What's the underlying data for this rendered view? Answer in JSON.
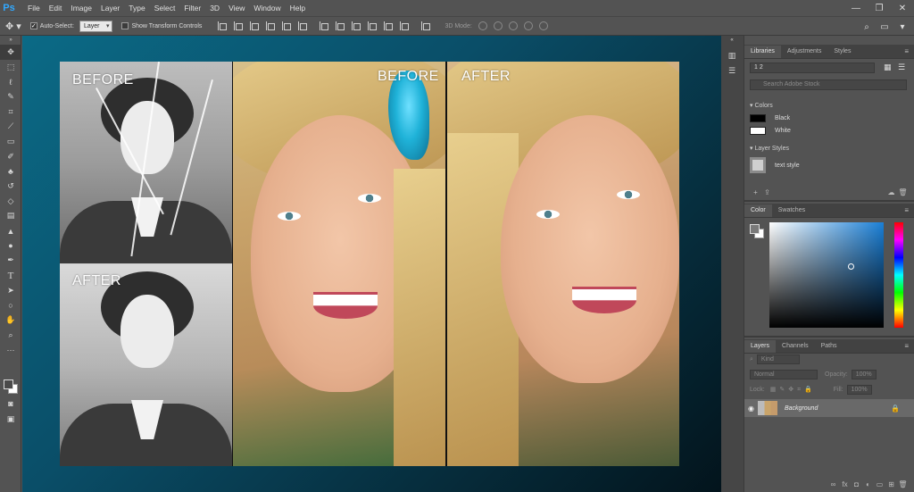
{
  "app": {
    "logo": "Ps"
  },
  "menu": [
    "File",
    "Edit",
    "Image",
    "Layer",
    "Type",
    "Select",
    "Filter",
    "3D",
    "View",
    "Window",
    "Help"
  ],
  "window_controls": [
    "—",
    "❐",
    "✕"
  ],
  "options": {
    "auto_select_label": "Auto-Select:",
    "auto_select_value": "Layer",
    "transform_label": "Show Transform Controls",
    "mode_3d": "3D Mode:"
  },
  "canvas": {
    "label_bw_before": "BEFORE",
    "label_bw_after": "AFTER",
    "label_before": "BEFORE",
    "label_after": "AFTER"
  },
  "libraries": {
    "tabs": [
      "Libraries",
      "Adjustments",
      "Styles"
    ],
    "library_name": "1 2",
    "search_placeholder": "Search Adobe Stock",
    "colors_header": "Colors",
    "colors": [
      {
        "name": "Black",
        "hex": "#000000"
      },
      {
        "name": "White",
        "hex": "#ffffff"
      }
    ],
    "layer_styles_header": "Layer Styles",
    "styles": [
      "text style"
    ]
  },
  "color_panel": {
    "tabs": [
      "Color",
      "Swatches"
    ]
  },
  "layers_panel": {
    "tabs": [
      "Layers",
      "Channels",
      "Paths"
    ],
    "kind": "Kind",
    "blend": "Normal",
    "opacity_label": "Opacity:",
    "opacity": "100%",
    "lock_label": "Lock:",
    "fill_label": "Fill:",
    "fill": "100%",
    "layer_name": "Background"
  },
  "colors": {
    "ui_bg": "#535353",
    "accent_blue": "#1a7fd6",
    "ps_blue": "#31a8ff"
  }
}
